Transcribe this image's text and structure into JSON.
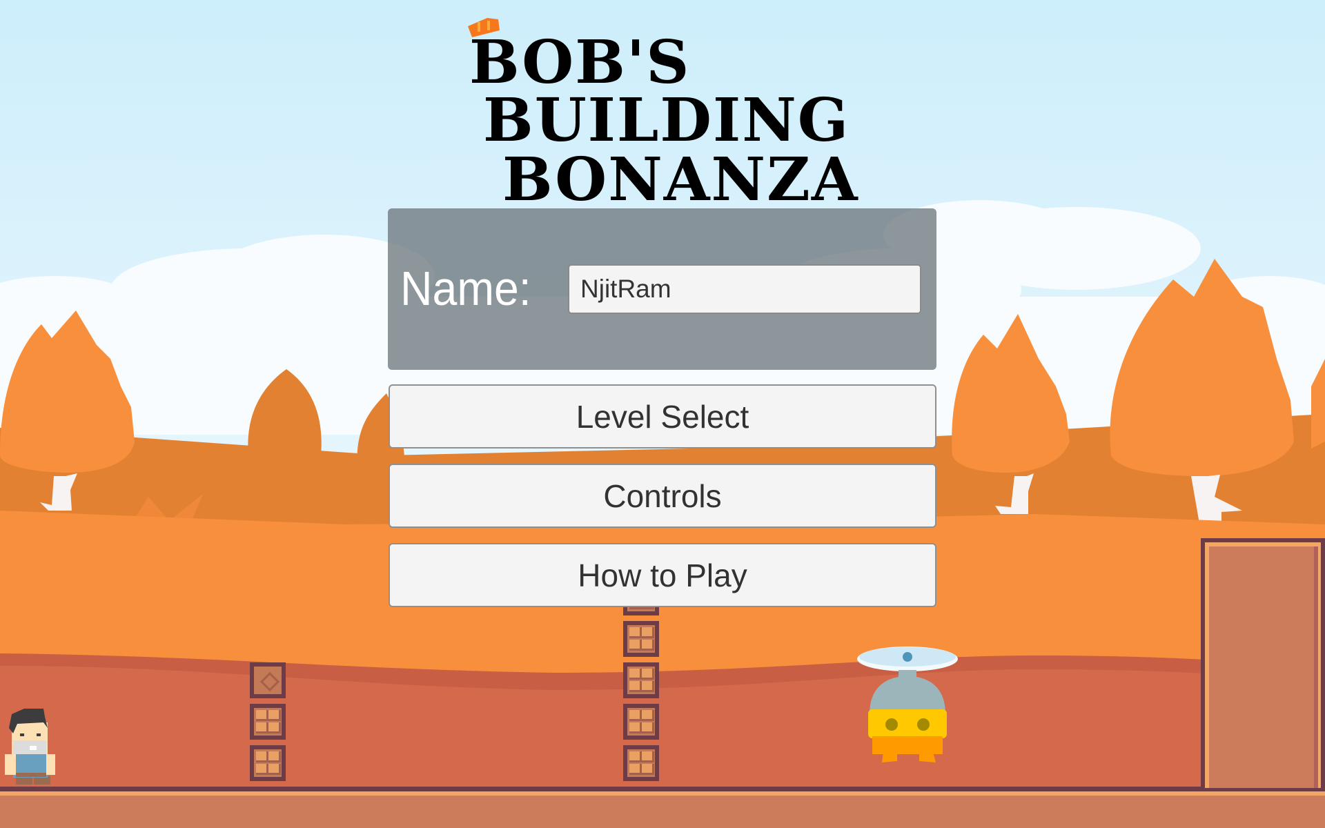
{
  "game": {
    "title_lines": [
      "BOB'S",
      "BUILDING",
      "BONANZA"
    ],
    "name_label": "Name:",
    "name_value": "NjitRam",
    "name_placeholder": "",
    "buttons": {
      "level_select": "Level Select",
      "controls": "Controls",
      "how_to_play": "How to Play"
    }
  },
  "colors": {
    "sky": "#cfeefa",
    "tree_orange": "#f78f3c",
    "hill_dark_orange": "#e38133",
    "ground_red": "#d5694b",
    "ground_floor": "#cc7c5b",
    "crate_border": "#6d3c46",
    "panel": "#7b8d94",
    "button_bg": "#f4f4f4"
  },
  "sprites": {
    "player": "bob-builder-character",
    "enemy": "propeller-bot",
    "hardhat": "orange-hardhat-icon"
  }
}
